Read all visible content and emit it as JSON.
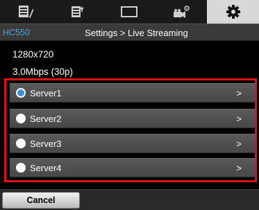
{
  "tabs": [
    {
      "icon": "edit-list-icon",
      "active": false
    },
    {
      "icon": "export-list-icon",
      "active": false
    },
    {
      "icon": "monitor-icon",
      "active": false
    },
    {
      "icon": "camera-settings-icon",
      "active": false
    },
    {
      "icon": "gear-icon",
      "active": true
    }
  ],
  "header": {
    "model": "HC550",
    "breadcrumb": "Settings > Live Streaming"
  },
  "info": {
    "resolution": "1280x720",
    "bitrate": "3.0Mbps (30p)"
  },
  "servers": [
    {
      "label": "Server1",
      "selected": true,
      "chevron": ">"
    },
    {
      "label": "Server2",
      "selected": false,
      "chevron": ">"
    },
    {
      "label": "Server3",
      "selected": false,
      "chevron": ">"
    },
    {
      "label": "Server4",
      "selected": false,
      "chevron": ">"
    }
  ],
  "footer": {
    "cancel_label": "Cancel"
  },
  "colors": {
    "accent": "#4aa8e0",
    "highlight": "#e01010",
    "radio_selected": "#3b8ede"
  }
}
